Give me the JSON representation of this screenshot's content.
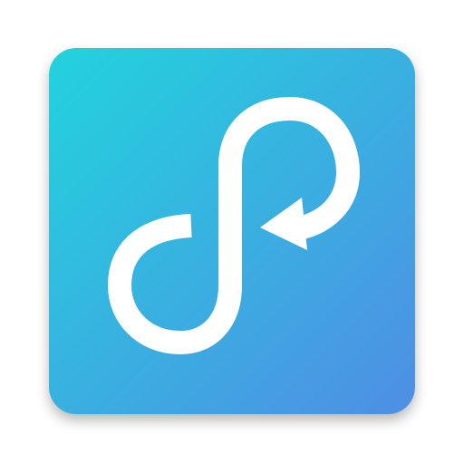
{
  "app_icon": {
    "name": "loop-arrow-icon",
    "gradient_start": "#22d3dd",
    "gradient_end": "#4f8ee4",
    "glyph_color": "#ffffff"
  }
}
